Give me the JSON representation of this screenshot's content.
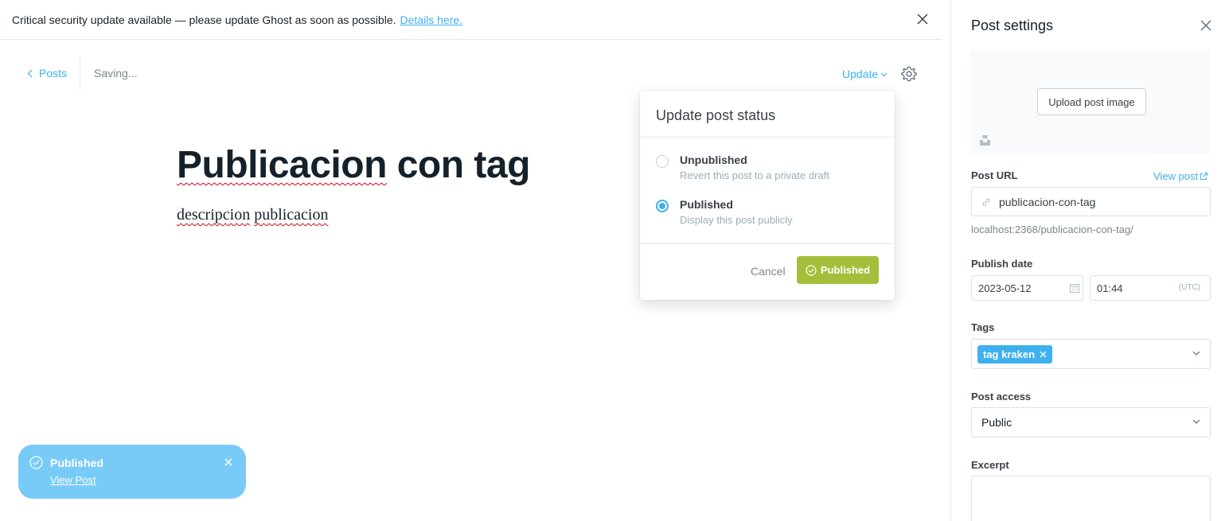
{
  "alert": {
    "message": "Critical security update available — please update Ghost as soon as possible.",
    "link_text": "Details here."
  },
  "editor": {
    "back_label": "Posts",
    "status": "Saving...",
    "update_label": "Update",
    "title_word_1": "Publicacion",
    "title_rest": " con tag",
    "excerpt_word_1": "descripcion",
    "excerpt_word_2": "publicacion"
  },
  "popover": {
    "title": "Update post status",
    "options": [
      {
        "label": "Unpublished",
        "description": "Revert this post to a private draft",
        "checked": false
      },
      {
        "label": "Published",
        "description": "Display this post publicly",
        "checked": true
      }
    ],
    "cancel_label": "Cancel",
    "confirm_label": "Published"
  },
  "toast": {
    "title": "Published",
    "link": "View Post"
  },
  "sidebar": {
    "title": "Post settings",
    "upload_label": "Upload post image",
    "post_url_label": "Post URL",
    "view_post_label": "View post",
    "post_url_value": "publicacion-con-tag",
    "post_url_hint": "localhost:2368/publicacion-con-tag/",
    "publish_date_label": "Publish date",
    "publish_date": "2023-05-12",
    "publish_time": "01:44",
    "timezone": "(UTC)",
    "tags_label": "Tags",
    "tags": [
      "tag kraken"
    ],
    "post_access_label": "Post access",
    "post_access_value": "Public",
    "excerpt_label": "Excerpt"
  },
  "colors": {
    "accent": "#3eb0ef",
    "publish_green": "#a4bf3b",
    "toast_bg": "#79cbf7",
    "text_dark": "#15212a"
  }
}
